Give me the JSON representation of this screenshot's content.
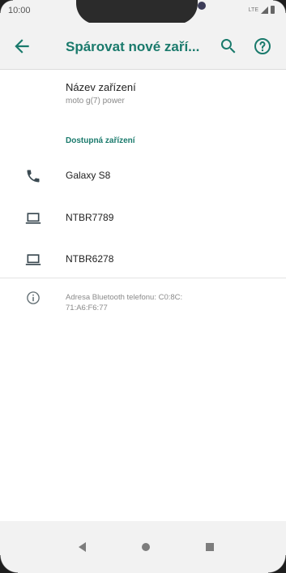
{
  "status_bar": {
    "time": "10:00",
    "network": "LTE"
  },
  "app_bar": {
    "title": "Spárovat nové zaří...",
    "back_icon": "arrow-left-icon",
    "search_icon": "search-icon",
    "help_icon": "help-circle-icon"
  },
  "device_name": {
    "title": "Název zařízení",
    "value": "moto g(7) power"
  },
  "available_section": {
    "header": "Dostupná zařízení",
    "devices": [
      {
        "label": "Galaxy S8",
        "icon": "phone-icon"
      },
      {
        "label": "NTBR7789",
        "icon": "laptop-icon"
      },
      {
        "label": "NTBR6278",
        "icon": "laptop-icon"
      }
    ]
  },
  "info": {
    "icon": "info-icon",
    "text": "Adresa Bluetooth telefonu: C0:8C:\n71:A6:F6:77"
  },
  "nav_bar": {
    "back_icon": "nav-back-icon",
    "home_icon": "nav-home-icon",
    "recents_icon": "nav-recents-icon"
  },
  "colors": {
    "accent": "#1a7a6c",
    "background": "#f2f2f2",
    "surface": "#ffffff",
    "secondary_text": "#8a8a8a"
  }
}
